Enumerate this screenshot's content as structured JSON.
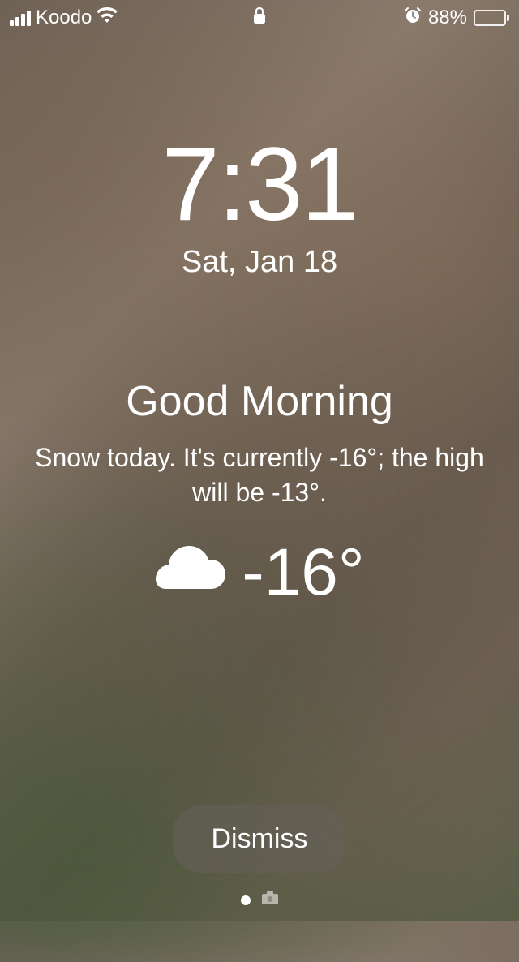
{
  "status_bar": {
    "carrier": "Koodo",
    "battery_percent": "88%"
  },
  "clock": {
    "time": "7:31",
    "date": "Sat, Jan 18"
  },
  "weather": {
    "greeting": "Good Morning",
    "summary": "Snow today. It's currently -16°; the high will be -13°.",
    "current_temp": "-16°"
  },
  "dismiss_label": "Dismiss"
}
